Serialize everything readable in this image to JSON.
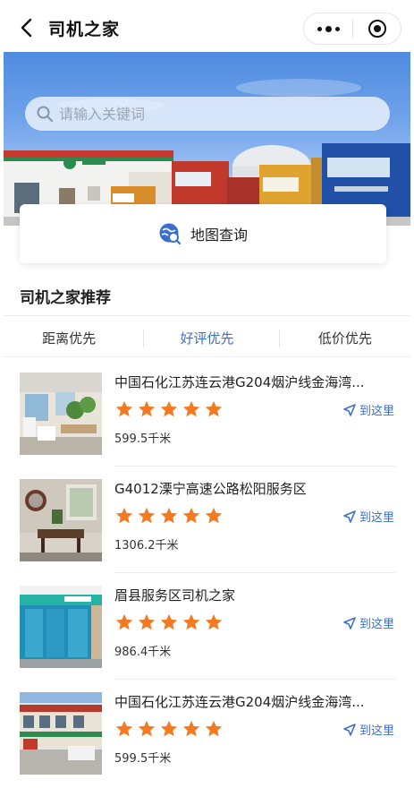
{
  "nav": {
    "title": "司机之家",
    "back_icon": "back-arrow-icon",
    "more_icon": "more-dots-icon",
    "close_icon": "target-circle-icon"
  },
  "search": {
    "placeholder": "请输入关键词",
    "icon": "search-icon"
  },
  "map_query": {
    "label": "地图查询",
    "icon": "map-search-icon"
  },
  "section": {
    "title": "司机之家推荐"
  },
  "tabs": [
    {
      "label": "距离优先",
      "active": false
    },
    {
      "label": "好评优先",
      "active": true
    },
    {
      "label": "低价优先",
      "active": false
    }
  ],
  "colors": {
    "accent": "#3b6fce",
    "star": "#f47a21",
    "text": "#222222"
  },
  "items": [
    {
      "name": "中国石化江苏连云港G204烟沪线金海湾...",
      "rating": 5,
      "distance": "599.5千米",
      "action": "到这里"
    },
    {
      "name": "G4012溧宁高速公路松阳服务区",
      "rating": 5,
      "distance": "1306.2千米",
      "action": "到这里"
    },
    {
      "name": "眉县服务区司机之家",
      "rating": 5,
      "distance": "986.4千米",
      "action": "到这里"
    },
    {
      "name": "中国石化江苏连云港G204烟沪线金海湾...",
      "rating": 5,
      "distance": "599.5千米",
      "action": "到这里"
    }
  ]
}
